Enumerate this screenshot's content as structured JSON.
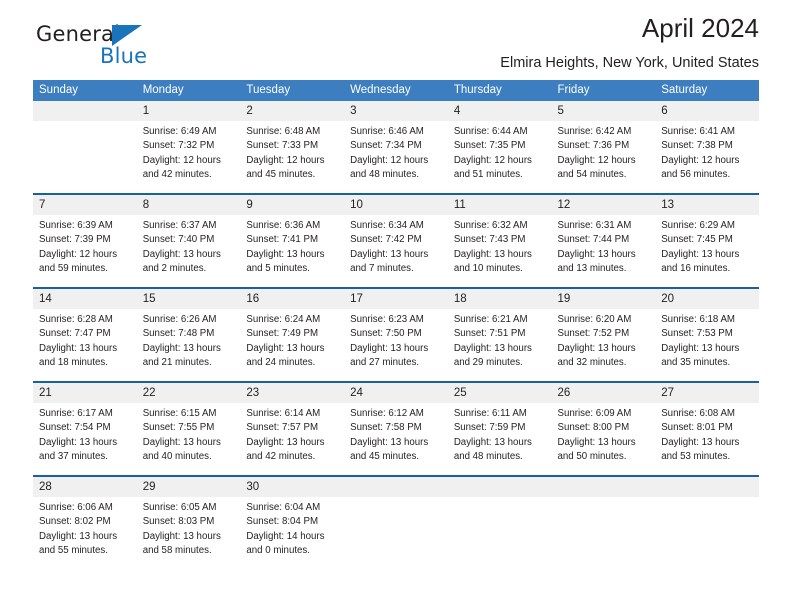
{
  "brand": {
    "name_part1": "General",
    "name_part2": "Blue",
    "triangle_color": "#1a74bb"
  },
  "header": {
    "title": "April 2024",
    "subtitle": "Elmira Heights, New York, United States"
  },
  "theme": {
    "header_bg": "#3c7ebf",
    "separator": "#1a5fa0",
    "daynum_bg": "#f0f0f0"
  },
  "weekdays": [
    "Sunday",
    "Monday",
    "Tuesday",
    "Wednesday",
    "Thursday",
    "Friday",
    "Saturday"
  ],
  "weeks": [
    {
      "days": [
        {
          "num": "",
          "sunrise": "",
          "sunset": "",
          "daylight1": "",
          "daylight2": ""
        },
        {
          "num": "1",
          "sunrise": "Sunrise: 6:49 AM",
          "sunset": "Sunset: 7:32 PM",
          "daylight1": "Daylight: 12 hours",
          "daylight2": "and 42 minutes."
        },
        {
          "num": "2",
          "sunrise": "Sunrise: 6:48 AM",
          "sunset": "Sunset: 7:33 PM",
          "daylight1": "Daylight: 12 hours",
          "daylight2": "and 45 minutes."
        },
        {
          "num": "3",
          "sunrise": "Sunrise: 6:46 AM",
          "sunset": "Sunset: 7:34 PM",
          "daylight1": "Daylight: 12 hours",
          "daylight2": "and 48 minutes."
        },
        {
          "num": "4",
          "sunrise": "Sunrise: 6:44 AM",
          "sunset": "Sunset: 7:35 PM",
          "daylight1": "Daylight: 12 hours",
          "daylight2": "and 51 minutes."
        },
        {
          "num": "5",
          "sunrise": "Sunrise: 6:42 AM",
          "sunset": "Sunset: 7:36 PM",
          "daylight1": "Daylight: 12 hours",
          "daylight2": "and 54 minutes."
        },
        {
          "num": "6",
          "sunrise": "Sunrise: 6:41 AM",
          "sunset": "Sunset: 7:38 PM",
          "daylight1": "Daylight: 12 hours",
          "daylight2": "and 56 minutes."
        }
      ]
    },
    {
      "days": [
        {
          "num": "7",
          "sunrise": "Sunrise: 6:39 AM",
          "sunset": "Sunset: 7:39 PM",
          "daylight1": "Daylight: 12 hours",
          "daylight2": "and 59 minutes."
        },
        {
          "num": "8",
          "sunrise": "Sunrise: 6:37 AM",
          "sunset": "Sunset: 7:40 PM",
          "daylight1": "Daylight: 13 hours",
          "daylight2": "and 2 minutes."
        },
        {
          "num": "9",
          "sunrise": "Sunrise: 6:36 AM",
          "sunset": "Sunset: 7:41 PM",
          "daylight1": "Daylight: 13 hours",
          "daylight2": "and 5 minutes."
        },
        {
          "num": "10",
          "sunrise": "Sunrise: 6:34 AM",
          "sunset": "Sunset: 7:42 PM",
          "daylight1": "Daylight: 13 hours",
          "daylight2": "and 7 minutes."
        },
        {
          "num": "11",
          "sunrise": "Sunrise: 6:32 AM",
          "sunset": "Sunset: 7:43 PM",
          "daylight1": "Daylight: 13 hours",
          "daylight2": "and 10 minutes."
        },
        {
          "num": "12",
          "sunrise": "Sunrise: 6:31 AM",
          "sunset": "Sunset: 7:44 PM",
          "daylight1": "Daylight: 13 hours",
          "daylight2": "and 13 minutes."
        },
        {
          "num": "13",
          "sunrise": "Sunrise: 6:29 AM",
          "sunset": "Sunset: 7:45 PM",
          "daylight1": "Daylight: 13 hours",
          "daylight2": "and 16 minutes."
        }
      ]
    },
    {
      "days": [
        {
          "num": "14",
          "sunrise": "Sunrise: 6:28 AM",
          "sunset": "Sunset: 7:47 PM",
          "daylight1": "Daylight: 13 hours",
          "daylight2": "and 18 minutes."
        },
        {
          "num": "15",
          "sunrise": "Sunrise: 6:26 AM",
          "sunset": "Sunset: 7:48 PM",
          "daylight1": "Daylight: 13 hours",
          "daylight2": "and 21 minutes."
        },
        {
          "num": "16",
          "sunrise": "Sunrise: 6:24 AM",
          "sunset": "Sunset: 7:49 PM",
          "daylight1": "Daylight: 13 hours",
          "daylight2": "and 24 minutes."
        },
        {
          "num": "17",
          "sunrise": "Sunrise: 6:23 AM",
          "sunset": "Sunset: 7:50 PM",
          "daylight1": "Daylight: 13 hours",
          "daylight2": "and 27 minutes."
        },
        {
          "num": "18",
          "sunrise": "Sunrise: 6:21 AM",
          "sunset": "Sunset: 7:51 PM",
          "daylight1": "Daylight: 13 hours",
          "daylight2": "and 29 minutes."
        },
        {
          "num": "19",
          "sunrise": "Sunrise: 6:20 AM",
          "sunset": "Sunset: 7:52 PM",
          "daylight1": "Daylight: 13 hours",
          "daylight2": "and 32 minutes."
        },
        {
          "num": "20",
          "sunrise": "Sunrise: 6:18 AM",
          "sunset": "Sunset: 7:53 PM",
          "daylight1": "Daylight: 13 hours",
          "daylight2": "and 35 minutes."
        }
      ]
    },
    {
      "days": [
        {
          "num": "21",
          "sunrise": "Sunrise: 6:17 AM",
          "sunset": "Sunset: 7:54 PM",
          "daylight1": "Daylight: 13 hours",
          "daylight2": "and 37 minutes."
        },
        {
          "num": "22",
          "sunrise": "Sunrise: 6:15 AM",
          "sunset": "Sunset: 7:55 PM",
          "daylight1": "Daylight: 13 hours",
          "daylight2": "and 40 minutes."
        },
        {
          "num": "23",
          "sunrise": "Sunrise: 6:14 AM",
          "sunset": "Sunset: 7:57 PM",
          "daylight1": "Daylight: 13 hours",
          "daylight2": "and 42 minutes."
        },
        {
          "num": "24",
          "sunrise": "Sunrise: 6:12 AM",
          "sunset": "Sunset: 7:58 PM",
          "daylight1": "Daylight: 13 hours",
          "daylight2": "and 45 minutes."
        },
        {
          "num": "25",
          "sunrise": "Sunrise: 6:11 AM",
          "sunset": "Sunset: 7:59 PM",
          "daylight1": "Daylight: 13 hours",
          "daylight2": "and 48 minutes."
        },
        {
          "num": "26",
          "sunrise": "Sunrise: 6:09 AM",
          "sunset": "Sunset: 8:00 PM",
          "daylight1": "Daylight: 13 hours",
          "daylight2": "and 50 minutes."
        },
        {
          "num": "27",
          "sunrise": "Sunrise: 6:08 AM",
          "sunset": "Sunset: 8:01 PM",
          "daylight1": "Daylight: 13 hours",
          "daylight2": "and 53 minutes."
        }
      ]
    },
    {
      "days": [
        {
          "num": "28",
          "sunrise": "Sunrise: 6:06 AM",
          "sunset": "Sunset: 8:02 PM",
          "daylight1": "Daylight: 13 hours",
          "daylight2": "and 55 minutes."
        },
        {
          "num": "29",
          "sunrise": "Sunrise: 6:05 AM",
          "sunset": "Sunset: 8:03 PM",
          "daylight1": "Daylight: 13 hours",
          "daylight2": "and 58 minutes."
        },
        {
          "num": "30",
          "sunrise": "Sunrise: 6:04 AM",
          "sunset": "Sunset: 8:04 PM",
          "daylight1": "Daylight: 14 hours",
          "daylight2": "and 0 minutes."
        },
        {
          "num": "",
          "sunrise": "",
          "sunset": "",
          "daylight1": "",
          "daylight2": ""
        },
        {
          "num": "",
          "sunrise": "",
          "sunset": "",
          "daylight1": "",
          "daylight2": ""
        },
        {
          "num": "",
          "sunrise": "",
          "sunset": "",
          "daylight1": "",
          "daylight2": ""
        },
        {
          "num": "",
          "sunrise": "",
          "sunset": "",
          "daylight1": "",
          "daylight2": ""
        }
      ]
    }
  ]
}
